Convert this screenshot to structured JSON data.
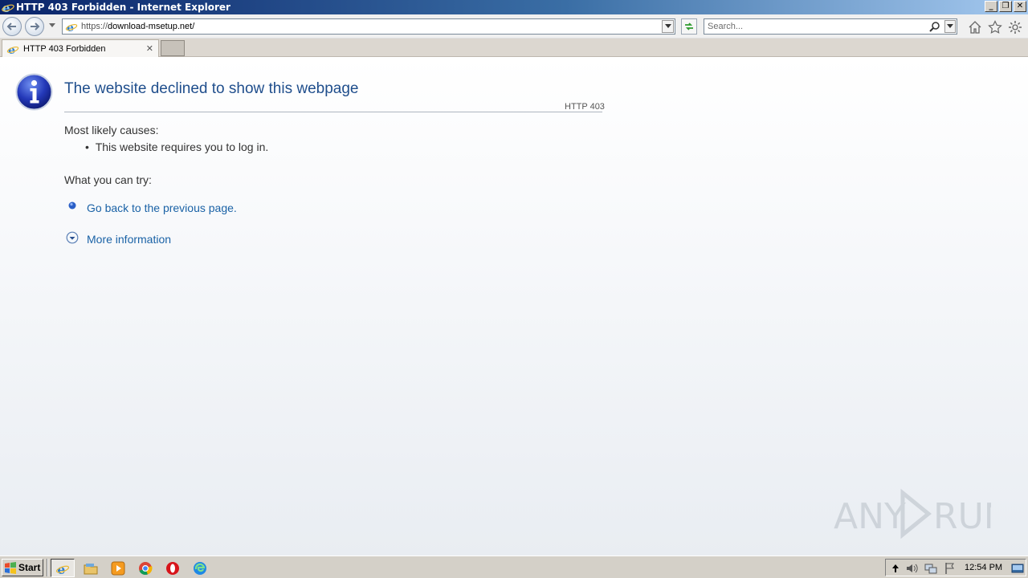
{
  "window": {
    "title": "HTTP 403 Forbidden - Internet Explorer",
    "minimize": "_",
    "restore": "❐",
    "close": "✕"
  },
  "nav": {
    "url_scheme": "https://",
    "url_host": "download-msetup.net/",
    "search_placeholder": "Search..."
  },
  "tabs": [
    {
      "label": "HTTP 403 Forbidden",
      "close": "✕"
    }
  ],
  "page": {
    "heading": "The website declined to show this webpage",
    "code": "HTTP 403",
    "causes_title": "Most likely causes:",
    "causes": [
      "This website requires you to log in."
    ],
    "try_title": "What you can try:",
    "go_back": "Go back to the previous page.",
    "more_info": "More information"
  },
  "watermark": {
    "text": "ANY RUN"
  },
  "taskbar": {
    "start_label": "Start",
    "clock": "12:54 PM"
  },
  "colors": {
    "heading": "#1f4e8c",
    "link": "#1a62a6",
    "titlebar_start": "#0a246a",
    "taskbar": "#d4d0c8"
  }
}
